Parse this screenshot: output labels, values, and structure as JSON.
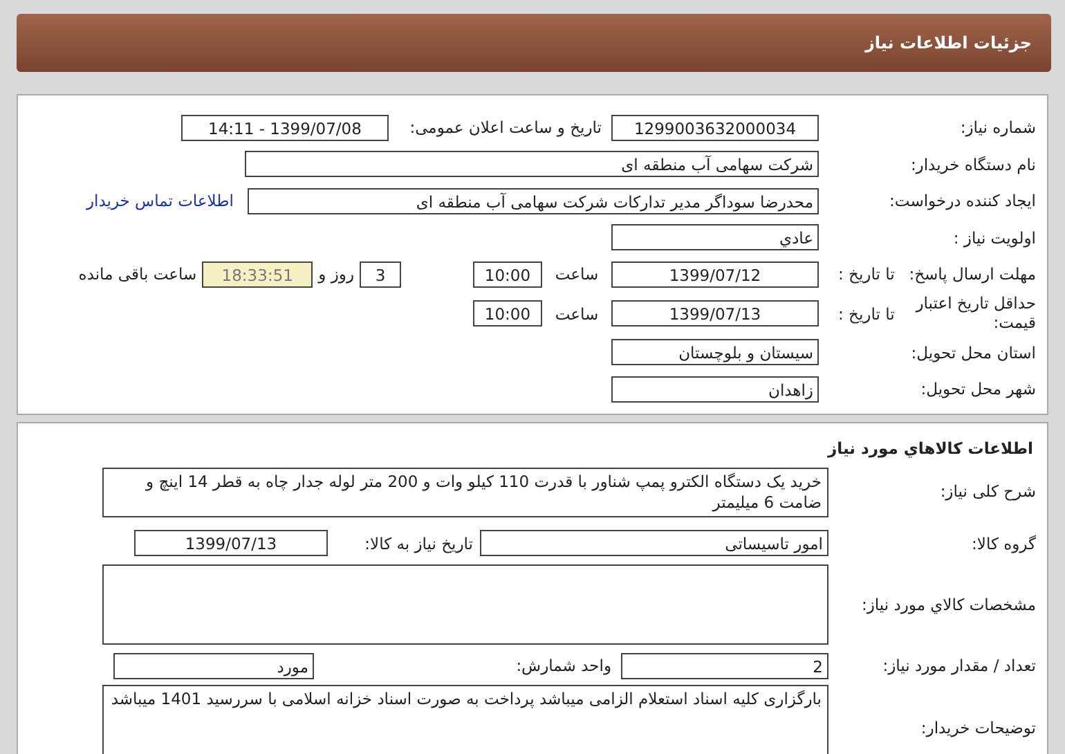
{
  "header": {
    "title": "جزئیات اطلاعات نیاز"
  },
  "general": {
    "need_number": {
      "label": "شماره نیاز:",
      "value": "1299003632000034"
    },
    "announce": {
      "label": "تاریخ و ساعت اعلان عمومی:",
      "value": "1399/07/08 - 14:11"
    },
    "buyer": {
      "label": "نام دستگاه خریدار:",
      "value": "شرکت سهامی آب منطقه ای"
    },
    "creator": {
      "label": "ایجاد کننده درخواست:",
      "value": "محدرضا سوداگر مدیر تداركات شركت سهامی آب منطقه ای",
      "link": "اطلاعات تماس خریدار"
    },
    "priority": {
      "label": "اولویت نیاز :",
      "value": "عادي"
    },
    "deadline": {
      "label": "مهلت ارسال پاسخ:",
      "to_label": "تا تاریخ :",
      "date": "1399/07/12",
      "time_label": "ساعت",
      "time": "10:00",
      "days": "3",
      "days_label": "روز و",
      "remaining": "18:33:51",
      "remaining_label": "ساعت باقی مانده"
    },
    "validity": {
      "label": "حداقل تاریخ اعتبار قیمت:",
      "to_label": "تا تاریخ :",
      "date": "1399/07/13",
      "time_label": "ساعت",
      "time": "10:00"
    },
    "province": {
      "label": "استان محل تحویل:",
      "value": "سیستان و بلوچستان"
    },
    "city": {
      "label": "شهر محل تحویل:",
      "value": "زاهدان"
    }
  },
  "goods": {
    "title": "اطلاعات کالاهاي مورد نیاز",
    "description": {
      "label": "شرح کلی نیاز:",
      "value": "خرید یک دستگاه الکترو پمپ شناور با قدرت 110 کیلو وات و 200 متر لوله جدار چاه به قطر 14 اینچ و ضامت 6 میلیمتر"
    },
    "group": {
      "label": "گروه کالا:",
      "value": "امور تاسیساتی",
      "need_date_label": "تاریخ نیاز به کالا:",
      "need_date": "1399/07/13"
    },
    "specs": {
      "label": "مشخصات کالاي مورد نیاز:"
    },
    "quantity": {
      "label": "تعداد / مقدار مورد نیاز:",
      "value": "2",
      "unit_label": "واحد شمارش:",
      "unit": "مورد"
    },
    "notes": {
      "label": "توضیحات خریدار:",
      "value": "بارگزاری کلیه اسناد استعلام الزامی میباشد پرداخت به صورت اسناد خزانه اسلامی با سررسید 1401 میباشد"
    }
  }
}
